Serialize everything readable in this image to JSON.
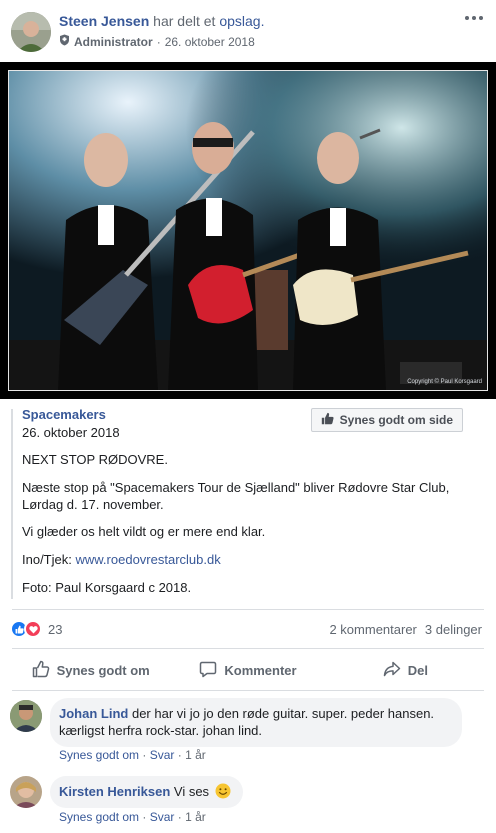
{
  "post": {
    "author": "Steen Jensen",
    "action_prefix": "har delt et",
    "action_link": "opslag.",
    "role": "Administrator",
    "separator": "·",
    "date": "26. oktober 2018"
  },
  "photo": {
    "credit": "Copyright © Paul Korsgaard"
  },
  "shared": {
    "page_name": "Spacemakers",
    "date": "26. oktober 2018",
    "like_page_label": "Synes godt om side",
    "line1": "NEXT STOP RØDOVRE.",
    "line2": "Næste stop på \"Spacemakers Tour de Sjælland\" bliver Rødovre Star Club, Lørdag d. 17. november.",
    "line3": "Vi glæder os helt vildt og er mere end klar.",
    "info_label": "Ino/Tjek:",
    "info_link": "www.roedovrestarclub.dk",
    "photo_credit": "Foto: Paul Korsgaard c 2018."
  },
  "stats": {
    "reaction_count": "23",
    "comments": "2 kommentarer",
    "shares": "3 delinger"
  },
  "actions": {
    "like": "Synes godt om",
    "comment": "Kommenter",
    "share": "Del"
  },
  "comments": [
    {
      "author": "Johan Lind",
      "text": "der har vi jo jo den røde guitar. super. peder hansen. kærligst herfra rock-star. johan lind.",
      "like": "Synes godt om",
      "reply": "Svar",
      "time": "1 år"
    },
    {
      "author": "Kirsten Henriksen",
      "text": "Vi ses",
      "emoji": "🙂",
      "like": "Synes godt om",
      "reply": "Svar",
      "time": "1 år"
    }
  ],
  "colors": {
    "link": "#385898",
    "like_blue": "#1877f2",
    "love_red": "#f33e58"
  }
}
